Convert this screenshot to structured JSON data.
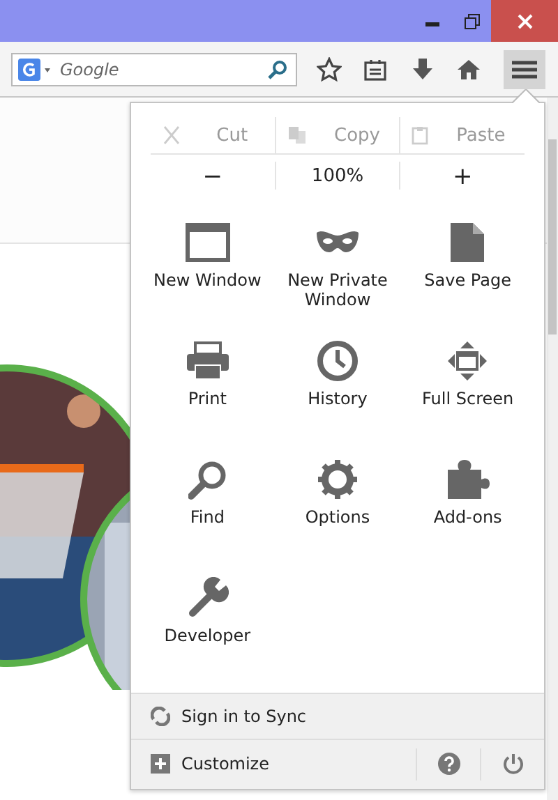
{
  "search": {
    "placeholder": "Google"
  },
  "edit_row": [
    {
      "label": "Cut",
      "disabled": true
    },
    {
      "label": "Copy",
      "disabled": true
    },
    {
      "label": "Paste",
      "disabled": true
    }
  ],
  "zoom": {
    "decrease": "−",
    "level": "100%",
    "increase": "+"
  },
  "items": [
    {
      "label": "New Window"
    },
    {
      "label": "New Private Window"
    },
    {
      "label": "Save Page"
    },
    {
      "label": "Print"
    },
    {
      "label": "History"
    },
    {
      "label": "Full Screen"
    },
    {
      "label": "Find"
    },
    {
      "label": "Options"
    },
    {
      "label": "Add-ons"
    },
    {
      "label": "Developer"
    }
  ],
  "sync": {
    "label": "Sign in to Sync"
  },
  "footer": {
    "customize": "Customize"
  }
}
